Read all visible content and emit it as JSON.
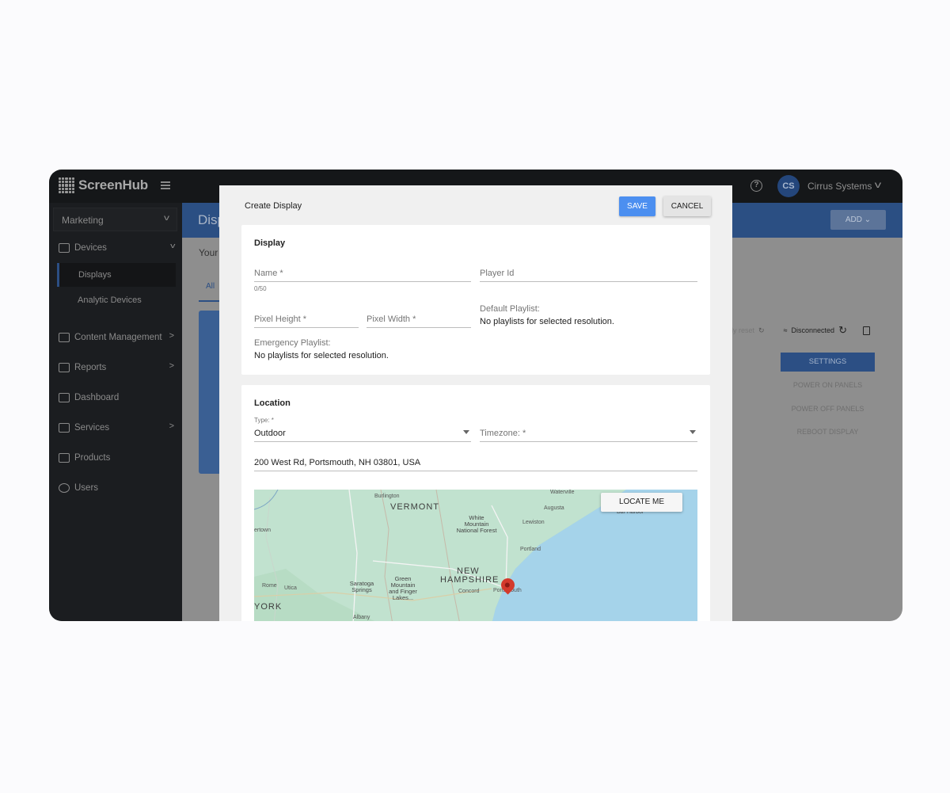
{
  "app": {
    "brand": "ScreenHub"
  },
  "topbar": {
    "help_icon": "?",
    "avatar_initials": "CS",
    "account_name": "Cirrus Systems"
  },
  "sidebar": {
    "workspace": "Marketing",
    "items": [
      {
        "label": "Devices",
        "icon": "devices-icon"
      },
      {
        "label": "Content Management",
        "icon": "image-icon"
      },
      {
        "label": "Reports",
        "icon": "chart-icon"
      },
      {
        "label": "Dashboard",
        "icon": "grid-icon"
      },
      {
        "label": "Services",
        "icon": "help-box-icon"
      },
      {
        "label": "Products",
        "icon": "bag-icon"
      },
      {
        "label": "Users",
        "icon": "users-icon"
      }
    ],
    "sub_items": [
      {
        "label": "Displays",
        "active": true
      },
      {
        "label": "Analytic Devices"
      }
    ]
  },
  "background": {
    "page_title": "Disp",
    "add_label": "ADD",
    "intro": "Your",
    "tab_all": "All",
    "status_faint": "ly reset",
    "status": "Disconnected",
    "buttons": [
      "SETTINGS",
      "POWER ON PANELS",
      "POWER OFF PANELS",
      "REBOOT DISPLAY"
    ]
  },
  "modal": {
    "title": "Create Display",
    "save_label": "SAVE",
    "cancel_label": "CANCEL",
    "display_card": {
      "heading": "Display",
      "name_label": "Name *",
      "name_counter": "0/50",
      "player_id_label": "Player Id",
      "pixel_height_label": "Pixel Height *",
      "pixel_width_label": "Pixel Width *",
      "default_playlist_label": "Default Playlist:",
      "default_playlist_value": "No playlists for selected resolution.",
      "emergency_playlist_label": "Emergency Playlist:",
      "emergency_playlist_value": "No playlists for selected resolution."
    },
    "location_card": {
      "heading": "Location",
      "type_label": "Type: *",
      "type_value": "Outdoor",
      "timezone_label": "Timezone: *",
      "address_value": "200 West Rd, Portsmouth, NH 03801, USA",
      "locate_label": "LOCATE ME",
      "map_labels": {
        "vermont": "VERMONT",
        "new_hampshire_1": "NEW",
        "new_hampshire_2": "HAMPSHIRE",
        "york": "YORK",
        "burlington": "Burlington",
        "waterville": "Waterville",
        "augusta": "Augusta",
        "bar_harbor": "Bar Harbor",
        "lewiston": "Lewiston",
        "white_mountain": "White\nMountain\nNational Forest",
        "portland": "Portland",
        "green_mountain": "Green\nMountain\nand Finger\nLakes...",
        "saratoga": "Saratoga\nSprings",
        "concord": "Concord",
        "portsmouth": "Portsmouth",
        "rome": "Rome",
        "utica": "Utica",
        "albany": "Albany",
        "watertown": "ertown"
      }
    }
  }
}
